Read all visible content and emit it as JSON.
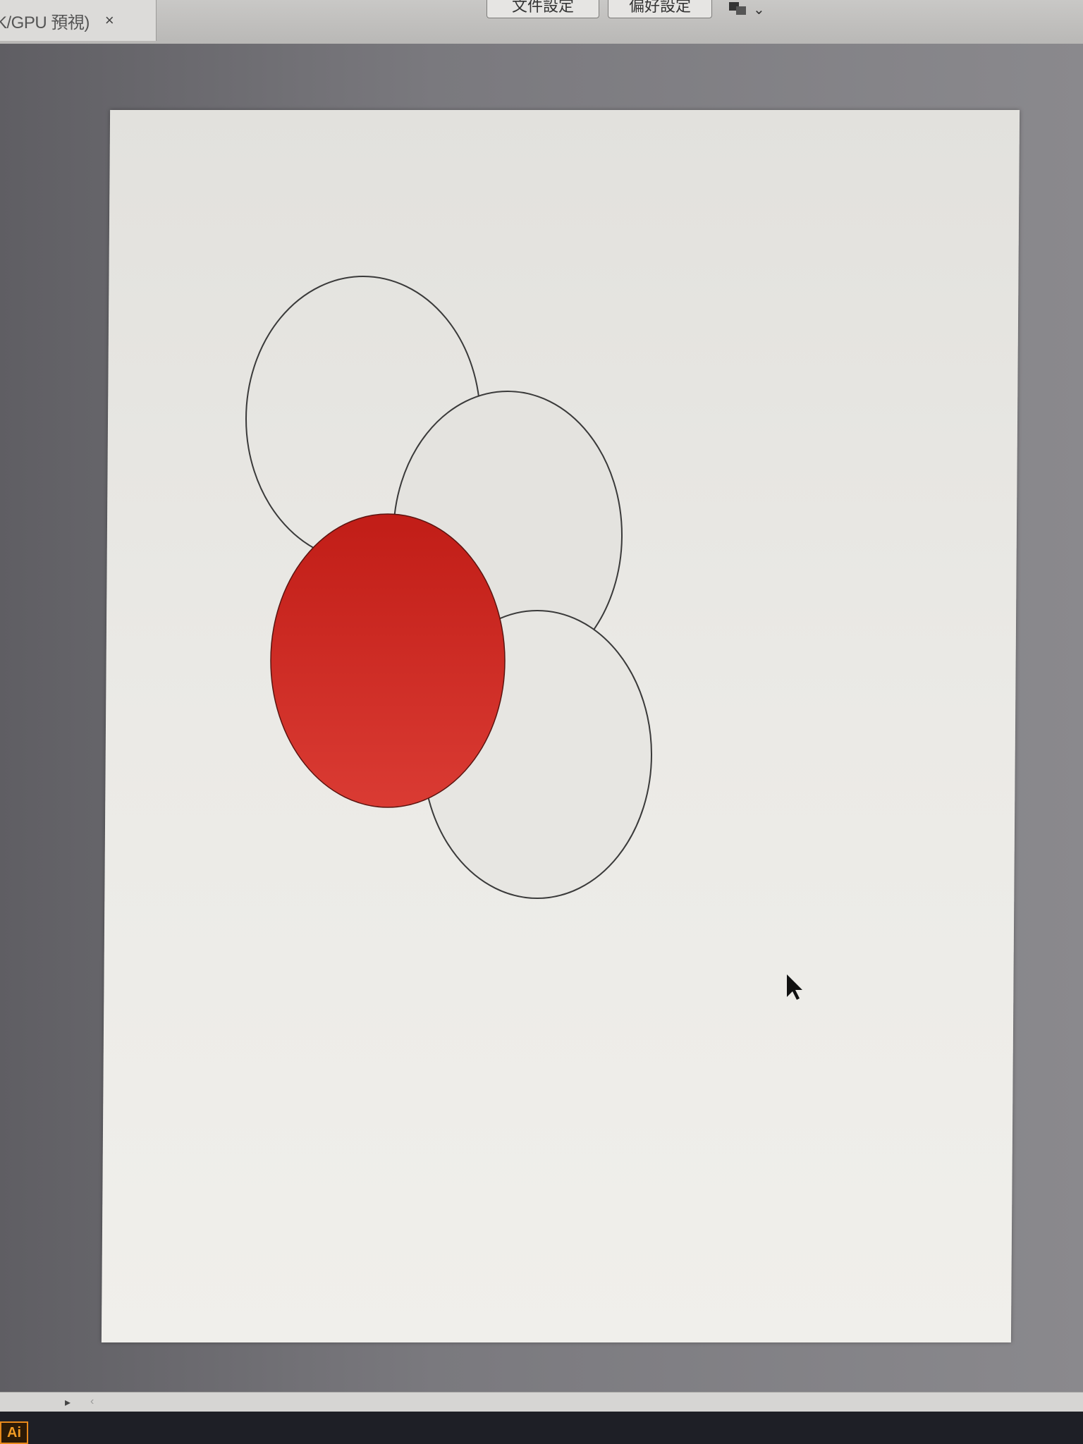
{
  "document_tab": {
    "label": "K/GPU 預視)",
    "close_glyph": "×"
  },
  "toolbar": {
    "document_setup_label": "文件設定",
    "preferences_label": "偏好設定",
    "arrange_icon": "arrange-icon",
    "dropdown_glyph": "⌄"
  },
  "colors": {
    "pasteboard": "#6f6e73",
    "artboard": "#ebeae6",
    "red_fill": "#cf2b22",
    "circle_stroke": "#3a3a3a"
  },
  "artwork": {
    "shapes": [
      {
        "name": "outline-circle-top",
        "fill": "none"
      },
      {
        "name": "outline-circle-middle",
        "fill": "none"
      },
      {
        "name": "outline-circle-bottom",
        "fill": "none"
      },
      {
        "name": "red-filled-circle",
        "fill": "#cf2b22"
      }
    ]
  },
  "status_bar": {
    "scroll_left_glyph": "▸",
    "scroll_prev_glyph": "‹"
  },
  "taskbar": {
    "app_icon_label": "Ai"
  }
}
